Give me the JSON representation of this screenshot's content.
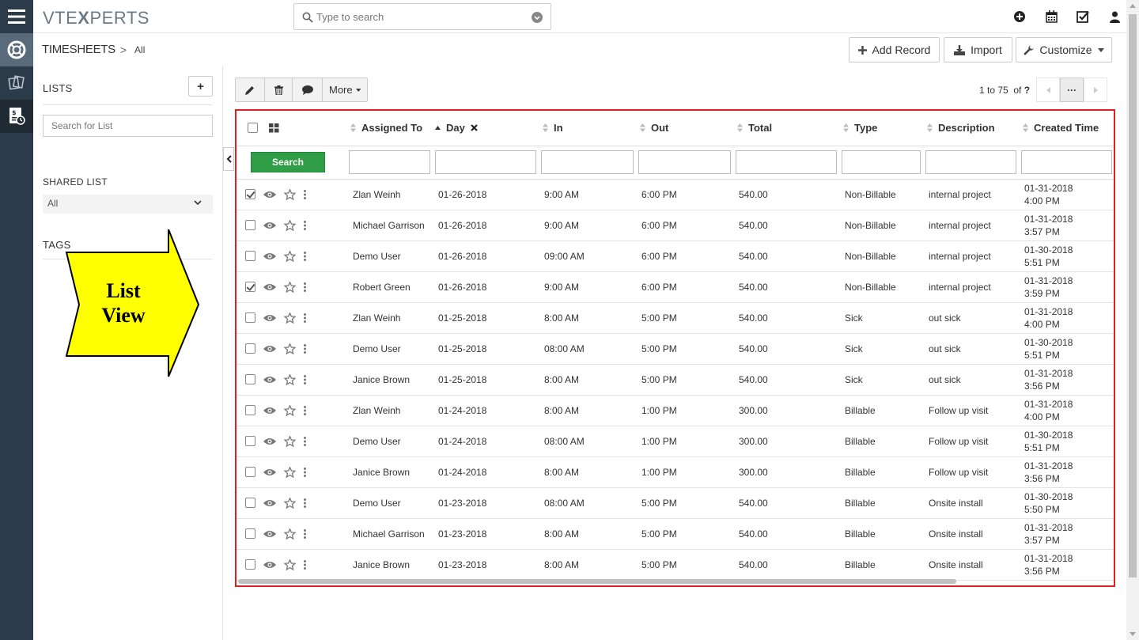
{
  "app": {
    "logo_prefix": "VTE",
    "logo_x": "X",
    "logo_suffix": "PERTS"
  },
  "search": {
    "placeholder": "Type to search"
  },
  "breadcrumb": {
    "module": "TIMESHEETS",
    "separator": ">",
    "filter": "All"
  },
  "header_buttons": {
    "add_record": "Add Record",
    "import": "Import",
    "customize": "Customize"
  },
  "left_panel": {
    "lists_title": "LISTS",
    "add_label": "+",
    "search_placeholder": "Search for List",
    "shared_list_title": "SHARED LIST",
    "shared_list_value": "All",
    "tags_title": "TAGS"
  },
  "annotation": {
    "line1": "List",
    "line2": "View"
  },
  "actions": {
    "more_label": "More"
  },
  "pager": {
    "range": "1 to 75",
    "of_label": "of",
    "total": "?",
    "dots": "···"
  },
  "table": {
    "columns": [
      "Assigned To",
      "Day",
      "In",
      "Out",
      "Total",
      "Type",
      "Description",
      "Created Time"
    ],
    "search_button": "Search",
    "rows": [
      {
        "checked": true,
        "assigned": "Zlan Weinh",
        "day": "01-26-2018",
        "in": "9:00 AM",
        "out": "6:00 PM",
        "total": "540.00",
        "type": "Non-Billable",
        "desc": "internal project",
        "created": "01-31-2018 4:00 PM"
      },
      {
        "checked": false,
        "assigned": "Michael Garrison",
        "day": "01-26-2018",
        "in": "9:00 AM",
        "out": "6:00 PM",
        "total": "540.00",
        "type": "Non-Billable",
        "desc": "internal project",
        "created": "01-31-2018 3:57 PM"
      },
      {
        "checked": false,
        "assigned": "Demo User",
        "day": "01-26-2018",
        "in": "09:00 AM",
        "out": "6:00 PM",
        "total": "540.00",
        "type": "Non-Billable",
        "desc": "internal project",
        "created": "01-30-2018 5:51 PM"
      },
      {
        "checked": true,
        "assigned": "Robert Green",
        "day": "01-26-2018",
        "in": "9:00 AM",
        "out": "6:00 PM",
        "total": "540.00",
        "type": "Non-Billable",
        "desc": "internal project",
        "created": "01-31-2018 3:59 PM"
      },
      {
        "checked": false,
        "assigned": "Zlan Weinh",
        "day": "01-25-2018",
        "in": "8:00 AM",
        "out": "5:00 PM",
        "total": "540.00",
        "type": "Sick",
        "desc": "out sick",
        "created": "01-31-2018 4:00 PM"
      },
      {
        "checked": false,
        "assigned": "Demo User",
        "day": "01-25-2018",
        "in": "08:00 AM",
        "out": "5:00 PM",
        "total": "540.00",
        "type": "Sick",
        "desc": "out sick",
        "created": "01-30-2018 5:51 PM"
      },
      {
        "checked": false,
        "assigned": "Janice Brown",
        "day": "01-25-2018",
        "in": "8:00 AM",
        "out": "5:00 PM",
        "total": "540.00",
        "type": "Sick",
        "desc": "out sick",
        "created": "01-31-2018 3:56 PM"
      },
      {
        "checked": false,
        "assigned": "Zlan Weinh",
        "day": "01-24-2018",
        "in": "8:00 AM",
        "out": "1:00 PM",
        "total": "300.00",
        "type": "Billable",
        "desc": "Follow up visit",
        "created": "01-31-2018 4:00 PM"
      },
      {
        "checked": false,
        "assigned": "Demo User",
        "day": "01-24-2018",
        "in": "08:00 AM",
        "out": "1:00 PM",
        "total": "300.00",
        "type": "Billable",
        "desc": "Follow up visit",
        "created": "01-30-2018 5:51 PM"
      },
      {
        "checked": false,
        "assigned": "Janice Brown",
        "day": "01-24-2018",
        "in": "8:00 AM",
        "out": "1:00 PM",
        "total": "300.00",
        "type": "Billable",
        "desc": "Follow up visit",
        "created": "01-31-2018 3:56 PM"
      },
      {
        "checked": false,
        "assigned": "Demo User",
        "day": "01-23-2018",
        "in": "08:00 AM",
        "out": "5:00 PM",
        "total": "540.00",
        "type": "Billable",
        "desc": "Onsite install",
        "created": "01-30-2018 5:50 PM"
      },
      {
        "checked": false,
        "assigned": "Michael Garrison",
        "day": "01-23-2018",
        "in": "8:00 AM",
        "out": "5:00 PM",
        "total": "540.00",
        "type": "Billable",
        "desc": "Onsite install",
        "created": "01-31-2018 3:57 PM"
      },
      {
        "checked": false,
        "assigned": "Janice Brown",
        "day": "01-23-2018",
        "in": "8:00 AM",
        "out": "5:00 PM",
        "total": "540.00",
        "type": "Billable",
        "desc": "Onsite install",
        "created": "01-31-2018 3:56 PM"
      }
    ]
  },
  "colors": {
    "link": "#3f6fb5",
    "search_button": "#2f9e46",
    "highlight_border": "#e02020",
    "rail": "#2c3b49",
    "annotation_fill": "#ffff00"
  }
}
